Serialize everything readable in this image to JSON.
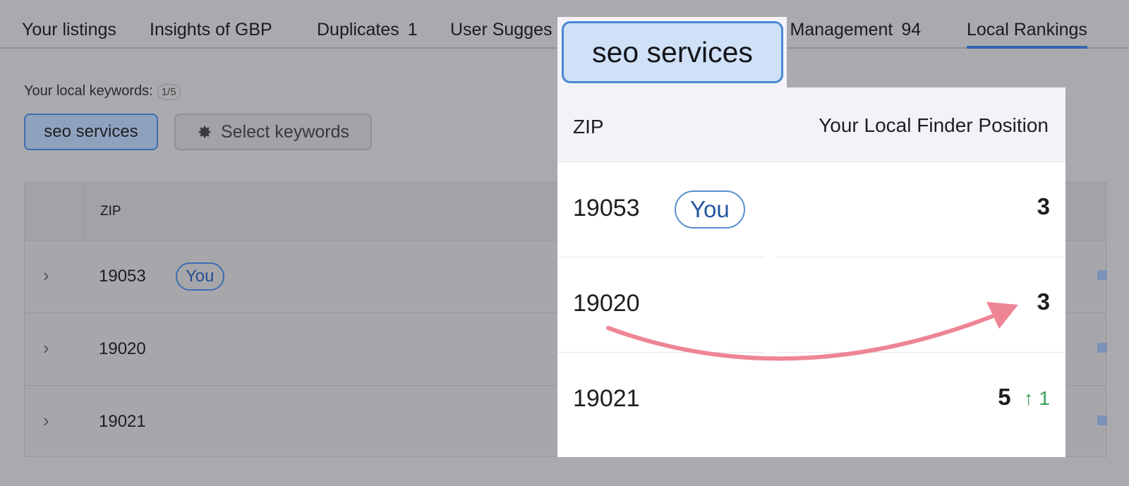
{
  "tabs": [
    {
      "label": "Your listings"
    },
    {
      "label": "Insights of GBP"
    },
    {
      "label": "Duplicates",
      "count": "1"
    },
    {
      "label": "User Sugges"
    },
    {
      "label": "v Management",
      "count": "94"
    },
    {
      "label": "Local Rankings",
      "active": true
    }
  ],
  "keywords": {
    "label": "Your local keywords:",
    "count": "1/5",
    "selected": "seo services",
    "select_button": "Select keywords",
    "icon": "gear-icon"
  },
  "table": {
    "columns": [
      "ZIP"
    ],
    "rows": [
      {
        "zip": "19053",
        "badge": "You"
      },
      {
        "zip": "19020"
      },
      {
        "zip": "19021"
      }
    ]
  },
  "callout": {
    "keyword": "seo services",
    "columns": [
      "ZIP",
      "Your Local Finder Position"
    ],
    "rows": [
      {
        "zip": "19053",
        "badge": "You",
        "position": "3"
      },
      {
        "zip": "19020",
        "position": "3"
      },
      {
        "zip": "19021",
        "position": "5",
        "change": "↑ 1"
      }
    ]
  },
  "colors": {
    "accent": "#2f67b0",
    "arrow": "#ee8595",
    "positive": "#3aa05a"
  }
}
